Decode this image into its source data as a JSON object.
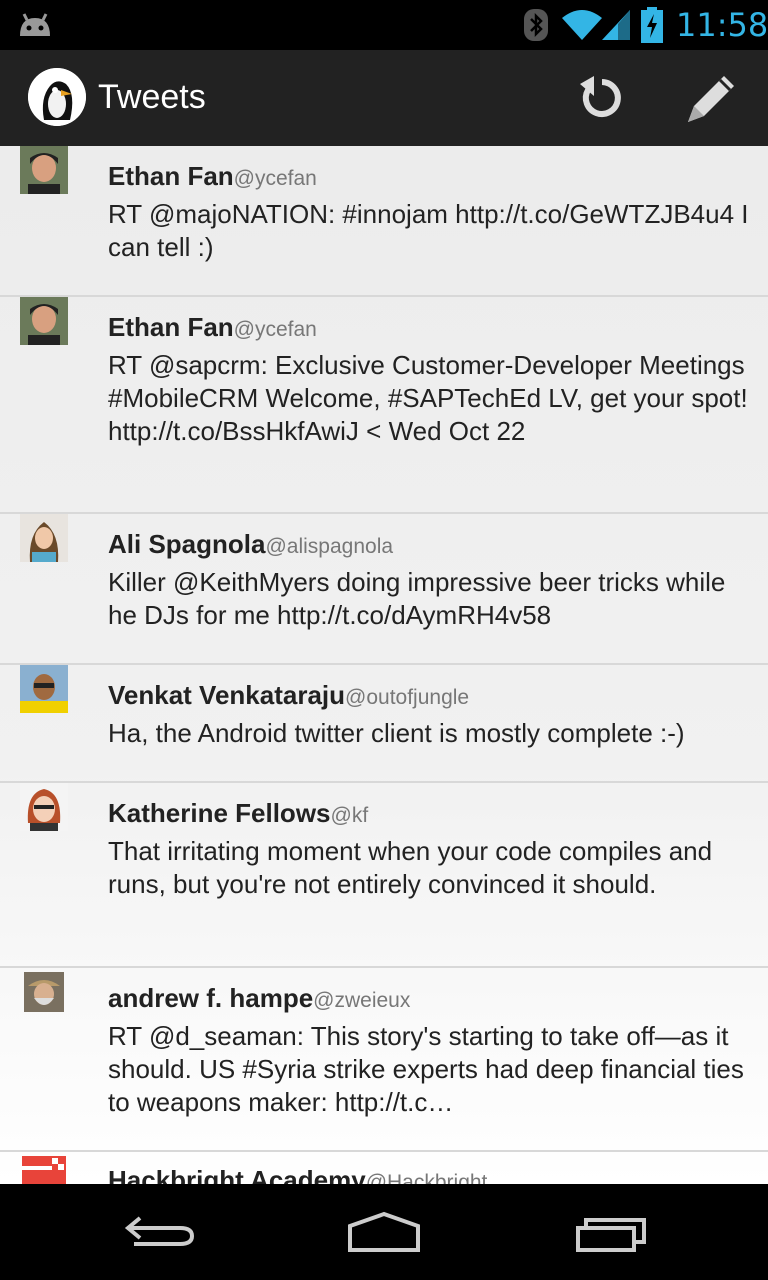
{
  "status_bar": {
    "time": "11:58"
  },
  "action_bar": {
    "title": "Tweets"
  },
  "tweets": [
    {
      "name": "Ethan Fan",
      "handle": "@ycefan",
      "text": "RT @majoNATION: #innojam http://t.co/GeWTZJB4u4 I can tell :)"
    },
    {
      "name": "Ethan Fan",
      "handle": "@ycefan",
      "text": "RT @sapcrm: Exclusive Customer-Developer Meetings #MobileCRM Welcome, #SAPTechEd LV, get your spot! http://t.co/BssHkfAwiJ < Wed Oct 22"
    },
    {
      "name": "Ali Spagnola",
      "handle": "@alispagnola",
      "text": "Killer @KeithMyers doing impressive beer tricks while he DJs for me http://t.co/dAymRH4v58"
    },
    {
      "name": "Venkat Venkataraju",
      "handle": "@outofjungle",
      "text": "Ha, the Android twitter client is mostly complete :-)"
    },
    {
      "name": "Katherine Fellows",
      "handle": "@kf",
      "text": "That irritating moment when your code compiles and runs, but you're not entirely convinced it should."
    },
    {
      "name": "andrew f. hampe",
      "handle": "@zweieux",
      "text": "RT @d_seaman: This story's starting to take off—as it should. US #Syria strike experts had deep financial ties to weapons maker: http://t.c…"
    },
    {
      "name": "Hackbright Academy",
      "handle": "@Hackbright",
      "text": ""
    }
  ]
}
